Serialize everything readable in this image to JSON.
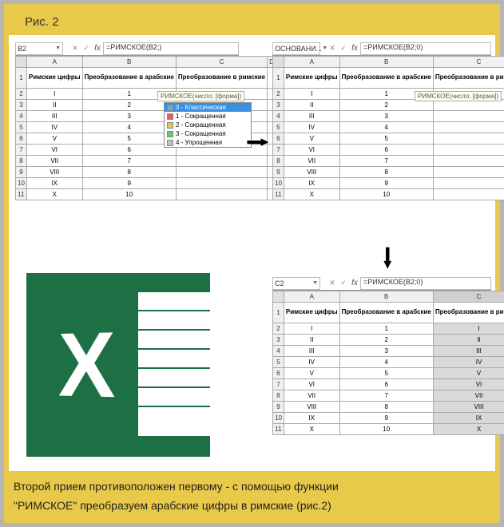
{
  "title": "Рис. 2",
  "caption_line1": "Второй прием противоположен первому - с помощью функции",
  "caption_line2": "\"РИМСКОЕ\" преобразуем арабские цифры в римские (рис.2)",
  "common_headers": {
    "col_a": "Римские цифры",
    "col_b": "Преобразование в арабские",
    "col_c": "Преобразование в римские"
  },
  "rows": [
    {
      "r": 2,
      "roman": "I",
      "arabic": "1"
    },
    {
      "r": 3,
      "roman": "II",
      "arabic": "2"
    },
    {
      "r": 4,
      "roman": "III",
      "arabic": "3"
    },
    {
      "r": 5,
      "roman": "IV",
      "arabic": "4"
    },
    {
      "r": 6,
      "roman": "V",
      "arabic": "5"
    },
    {
      "r": 7,
      "roman": "VI",
      "arabic": "6"
    },
    {
      "r": 8,
      "roman": "VII",
      "arabic": "7"
    },
    {
      "r": 9,
      "roman": "VIII",
      "arabic": "8"
    },
    {
      "r": 10,
      "roman": "IX",
      "arabic": "9"
    },
    {
      "r": 11,
      "roman": "X",
      "arabic": "10"
    }
  ],
  "sheet1": {
    "namebox": "B2",
    "formula": "=РИМСКОЕ(B2;)",
    "cell_c2": "=РИМСКОЕ(B2;)",
    "hint": "РИМСКОЕ(число; [форма])",
    "options": [
      {
        "n": "0",
        "label": "Классическая",
        "color": "#6aa9e0",
        "sel": true
      },
      {
        "n": "1",
        "label": "Сокращенная",
        "color": "#e85c5c"
      },
      {
        "n": "2",
        "label": "Сокращенная",
        "color": "#e0c64a"
      },
      {
        "n": "3",
        "label": "Сокращенная",
        "color": "#6ac46a"
      },
      {
        "n": "4",
        "label": "Упрощенная",
        "color": "#c0c0c0"
      }
    ]
  },
  "sheet2": {
    "namebox": "ОСНОВАНИ...",
    "formula": "=РИМСКОЕ(B2;0)",
    "cell_c2": "=РИМСКОЕ(B2;0)",
    "hint": "РИМСКОЕ(число; [форма])"
  },
  "sheet3": {
    "namebox": "C2",
    "formula": "=РИМСКОЕ(B2;0)",
    "results": [
      "I",
      "II",
      "III",
      "IV",
      "V",
      "VI",
      "VII",
      "VIII",
      "IX",
      "X"
    ]
  },
  "columns": [
    "A",
    "B",
    "C",
    "D"
  ],
  "logo_letter": "X"
}
